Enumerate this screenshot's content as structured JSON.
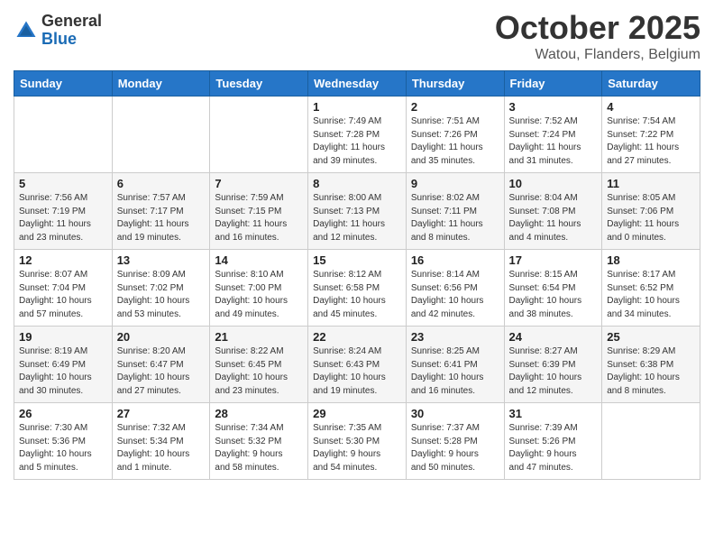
{
  "logo": {
    "general": "General",
    "blue": "Blue"
  },
  "header": {
    "month": "October 2025",
    "location": "Watou, Flanders, Belgium"
  },
  "weekdays": [
    "Sunday",
    "Monday",
    "Tuesday",
    "Wednesday",
    "Thursday",
    "Friday",
    "Saturday"
  ],
  "weeks": [
    [
      {
        "day": "",
        "info": ""
      },
      {
        "day": "",
        "info": ""
      },
      {
        "day": "",
        "info": ""
      },
      {
        "day": "1",
        "info": "Sunrise: 7:49 AM\nSunset: 7:28 PM\nDaylight: 11 hours\nand 39 minutes."
      },
      {
        "day": "2",
        "info": "Sunrise: 7:51 AM\nSunset: 7:26 PM\nDaylight: 11 hours\nand 35 minutes."
      },
      {
        "day": "3",
        "info": "Sunrise: 7:52 AM\nSunset: 7:24 PM\nDaylight: 11 hours\nand 31 minutes."
      },
      {
        "day": "4",
        "info": "Sunrise: 7:54 AM\nSunset: 7:22 PM\nDaylight: 11 hours\nand 27 minutes."
      }
    ],
    [
      {
        "day": "5",
        "info": "Sunrise: 7:56 AM\nSunset: 7:19 PM\nDaylight: 11 hours\nand 23 minutes."
      },
      {
        "day": "6",
        "info": "Sunrise: 7:57 AM\nSunset: 7:17 PM\nDaylight: 11 hours\nand 19 minutes."
      },
      {
        "day": "7",
        "info": "Sunrise: 7:59 AM\nSunset: 7:15 PM\nDaylight: 11 hours\nand 16 minutes."
      },
      {
        "day": "8",
        "info": "Sunrise: 8:00 AM\nSunset: 7:13 PM\nDaylight: 11 hours\nand 12 minutes."
      },
      {
        "day": "9",
        "info": "Sunrise: 8:02 AM\nSunset: 7:11 PM\nDaylight: 11 hours\nand 8 minutes."
      },
      {
        "day": "10",
        "info": "Sunrise: 8:04 AM\nSunset: 7:08 PM\nDaylight: 11 hours\nand 4 minutes."
      },
      {
        "day": "11",
        "info": "Sunrise: 8:05 AM\nSunset: 7:06 PM\nDaylight: 11 hours\nand 0 minutes."
      }
    ],
    [
      {
        "day": "12",
        "info": "Sunrise: 8:07 AM\nSunset: 7:04 PM\nDaylight: 10 hours\nand 57 minutes."
      },
      {
        "day": "13",
        "info": "Sunrise: 8:09 AM\nSunset: 7:02 PM\nDaylight: 10 hours\nand 53 minutes."
      },
      {
        "day": "14",
        "info": "Sunrise: 8:10 AM\nSunset: 7:00 PM\nDaylight: 10 hours\nand 49 minutes."
      },
      {
        "day": "15",
        "info": "Sunrise: 8:12 AM\nSunset: 6:58 PM\nDaylight: 10 hours\nand 45 minutes."
      },
      {
        "day": "16",
        "info": "Sunrise: 8:14 AM\nSunset: 6:56 PM\nDaylight: 10 hours\nand 42 minutes."
      },
      {
        "day": "17",
        "info": "Sunrise: 8:15 AM\nSunset: 6:54 PM\nDaylight: 10 hours\nand 38 minutes."
      },
      {
        "day": "18",
        "info": "Sunrise: 8:17 AM\nSunset: 6:52 PM\nDaylight: 10 hours\nand 34 minutes."
      }
    ],
    [
      {
        "day": "19",
        "info": "Sunrise: 8:19 AM\nSunset: 6:49 PM\nDaylight: 10 hours\nand 30 minutes."
      },
      {
        "day": "20",
        "info": "Sunrise: 8:20 AM\nSunset: 6:47 PM\nDaylight: 10 hours\nand 27 minutes."
      },
      {
        "day": "21",
        "info": "Sunrise: 8:22 AM\nSunset: 6:45 PM\nDaylight: 10 hours\nand 23 minutes."
      },
      {
        "day": "22",
        "info": "Sunrise: 8:24 AM\nSunset: 6:43 PM\nDaylight: 10 hours\nand 19 minutes."
      },
      {
        "day": "23",
        "info": "Sunrise: 8:25 AM\nSunset: 6:41 PM\nDaylight: 10 hours\nand 16 minutes."
      },
      {
        "day": "24",
        "info": "Sunrise: 8:27 AM\nSunset: 6:39 PM\nDaylight: 10 hours\nand 12 minutes."
      },
      {
        "day": "25",
        "info": "Sunrise: 8:29 AM\nSunset: 6:38 PM\nDaylight: 10 hours\nand 8 minutes."
      }
    ],
    [
      {
        "day": "26",
        "info": "Sunrise: 7:30 AM\nSunset: 5:36 PM\nDaylight: 10 hours\nand 5 minutes."
      },
      {
        "day": "27",
        "info": "Sunrise: 7:32 AM\nSunset: 5:34 PM\nDaylight: 10 hours\nand 1 minute."
      },
      {
        "day": "28",
        "info": "Sunrise: 7:34 AM\nSunset: 5:32 PM\nDaylight: 9 hours\nand 58 minutes."
      },
      {
        "day": "29",
        "info": "Sunrise: 7:35 AM\nSunset: 5:30 PM\nDaylight: 9 hours\nand 54 minutes."
      },
      {
        "day": "30",
        "info": "Sunrise: 7:37 AM\nSunset: 5:28 PM\nDaylight: 9 hours\nand 50 minutes."
      },
      {
        "day": "31",
        "info": "Sunrise: 7:39 AM\nSunset: 5:26 PM\nDaylight: 9 hours\nand 47 minutes."
      },
      {
        "day": "",
        "info": ""
      }
    ]
  ]
}
